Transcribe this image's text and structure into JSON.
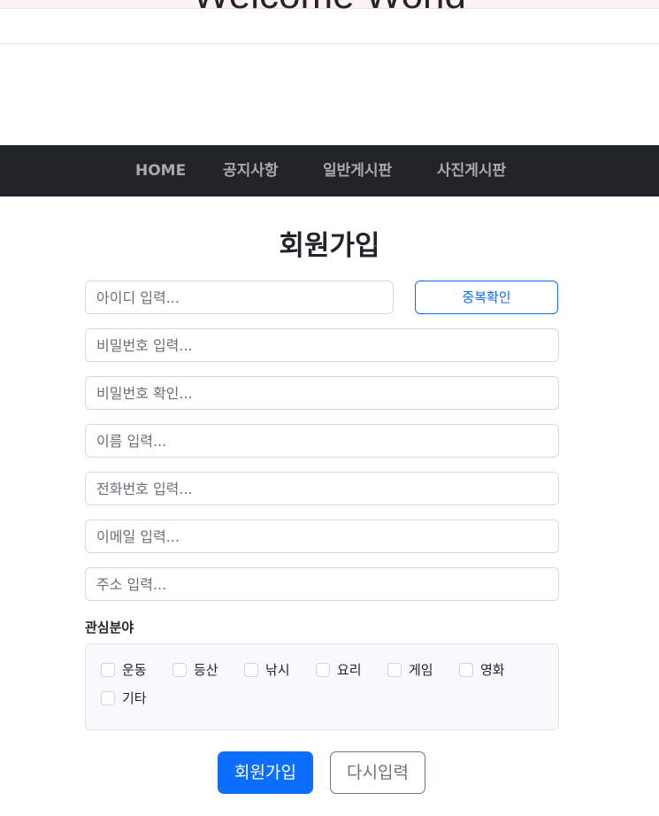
{
  "header": {
    "title": "Welcome World"
  },
  "nav": {
    "items": [
      {
        "label": "HOME"
      },
      {
        "label": "공지사항"
      },
      {
        "label": "일반게시판"
      },
      {
        "label": "사진게시판"
      }
    ]
  },
  "form": {
    "title": "회원가입",
    "fields": {
      "user_id": {
        "value": "",
        "placeholder": "아이디 입력..."
      },
      "password": {
        "value": "",
        "placeholder": "비밀번호 입력..."
      },
      "password_confirm": {
        "value": "",
        "placeholder": "비밀번호 확인..."
      },
      "name": {
        "value": "",
        "placeholder": "이름 입력..."
      },
      "phone": {
        "value": "",
        "placeholder": "전화번호 입력..."
      },
      "email": {
        "value": "",
        "placeholder": "이메일 입력..."
      },
      "address": {
        "value": "",
        "placeholder": "주소 입력..."
      }
    },
    "duplicate_check_label": "중복확인",
    "interests": {
      "label": "관심분야",
      "options": [
        {
          "label": "운동",
          "checked": false
        },
        {
          "label": "등산",
          "checked": false
        },
        {
          "label": "낚시",
          "checked": false
        },
        {
          "label": "요리",
          "checked": false
        },
        {
          "label": "게임",
          "checked": false
        },
        {
          "label": "영화",
          "checked": false
        },
        {
          "label": "기타",
          "checked": false
        }
      ]
    },
    "submit_label": "회원가입",
    "reset_label": "다시입력"
  },
  "colors": {
    "primary": "#0d6efd",
    "navbar_bg": "#212529",
    "nav_text": "#a8aaad",
    "secondary": "#6c757d"
  }
}
